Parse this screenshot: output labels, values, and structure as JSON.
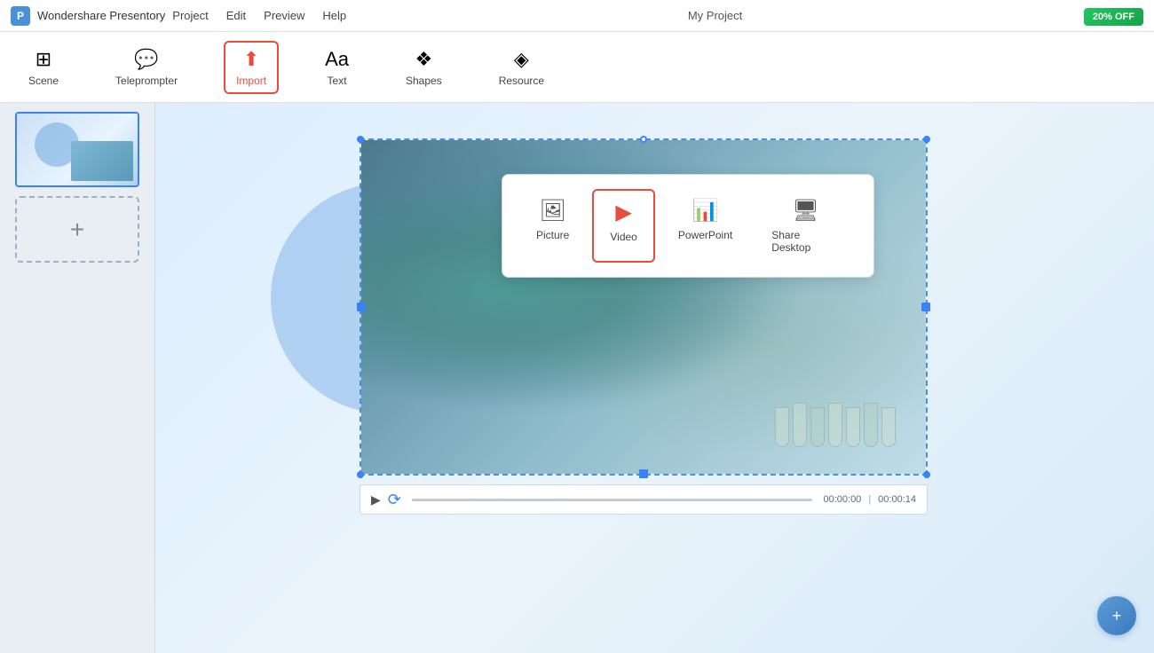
{
  "app": {
    "name": "Wondershare Presentory",
    "logo_char": "P",
    "project_name": "My Project",
    "promo_badge": "20% OFF"
  },
  "title_menus": {
    "project": "Project",
    "edit": "Edit",
    "preview": "Preview",
    "help": "Help"
  },
  "toolbar": {
    "scene_label": "Scene",
    "teleprompter_label": "Teleprompter",
    "import_label": "Import",
    "text_label": "Text",
    "shapes_label": "Shapes",
    "resource_label": "Resource"
  },
  "import_dropdown": {
    "picture_label": "Picture",
    "video_label": "Video",
    "powerpoint_label": "PowerPoint",
    "share_desktop_label": "Share Desktop"
  },
  "video_controls": {
    "time_current": "00:00:00",
    "time_total": "00:00:14"
  },
  "fab": {
    "icon": "+"
  }
}
